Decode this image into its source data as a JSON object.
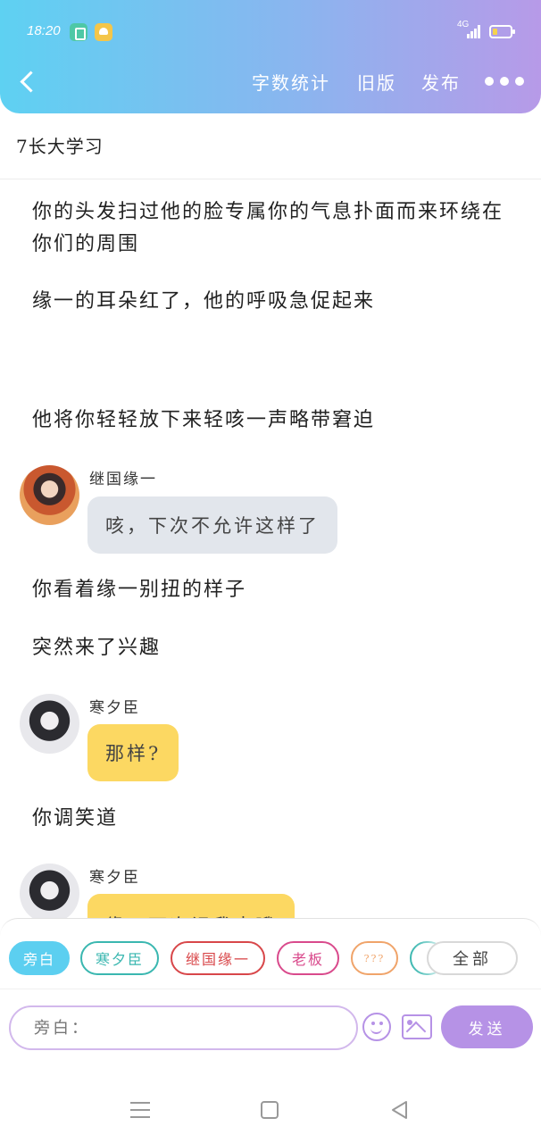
{
  "status_bar": {
    "time": "18:20",
    "network": "4G"
  },
  "header": {
    "word_count_label": "字数统计",
    "old_version_label": "旧版",
    "publish_label": "发布"
  },
  "document": {
    "title": "7长大学习"
  },
  "messages": [
    {
      "type": "narration",
      "text": "你的头发扫过他的脸专属你的气息扑面而来环绕在你们的周围"
    },
    {
      "type": "narration",
      "text": "缘一的耳朵红了，他的呼吸急促起来"
    },
    {
      "type": "narration",
      "text": "他将你轻轻放下来轻咳一声略带窘迫"
    },
    {
      "type": "dialogue",
      "speaker": "继国缘一",
      "text": "咳，下次不允许这样了"
    },
    {
      "type": "narration",
      "text": "你看着缘一别扭的样子"
    },
    {
      "type": "narration",
      "text": "突然来了兴趣"
    },
    {
      "type": "dialogue",
      "speaker": "寒夕臣",
      "text": "那样?"
    },
    {
      "type": "narration",
      "text": "你调笑道"
    },
    {
      "type": "dialogue",
      "speaker": "寒夕臣",
      "text": "缘一下次记我來哦"
    }
  ],
  "roles": {
    "chips": [
      {
        "label": "旁白",
        "color": "#5ccff0"
      },
      {
        "label": "寒夕臣",
        "color": "#3ab7b0"
      },
      {
        "label": "继国缘一",
        "color": "#d8474a"
      },
      {
        "label": "老板",
        "color": "#d94a8c"
      },
      {
        "label": "???",
        "color": "#f0a46a"
      }
    ],
    "all_label": "全部"
  },
  "composer": {
    "placeholder": "旁白：",
    "send_label": "发送"
  },
  "colors": {
    "accent": "#b692e6",
    "header_start": "#5ed1f2",
    "header_end": "#b79ae8"
  }
}
